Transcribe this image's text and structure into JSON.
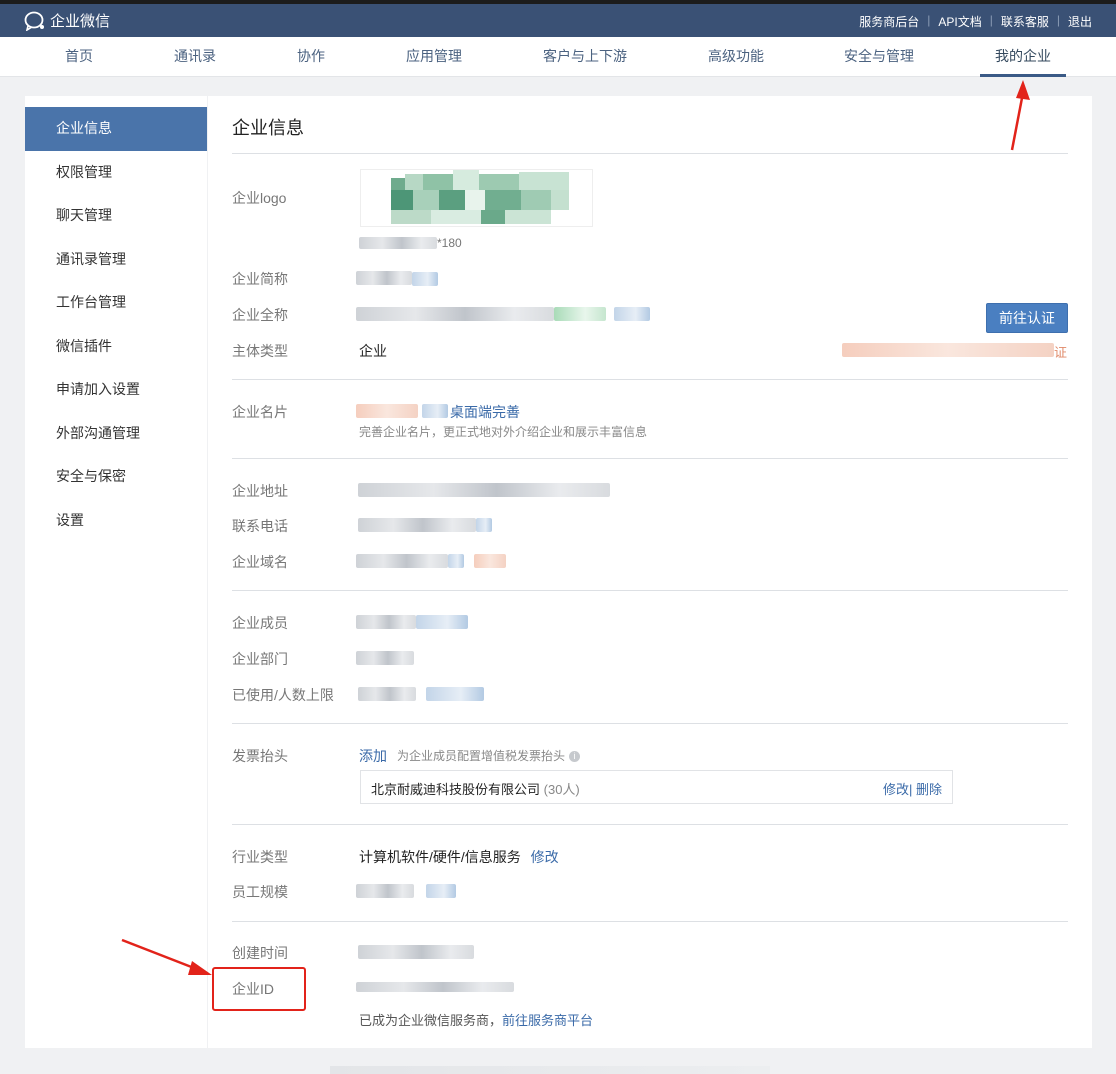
{
  "app": {
    "title": "企业微信"
  },
  "toplinks": [
    {
      "label": "服务商后台"
    },
    {
      "label": "API文档"
    },
    {
      "label": "联系客服"
    },
    {
      "label": "退出"
    }
  ],
  "nav": [
    {
      "label": "首页"
    },
    {
      "label": "通讯录"
    },
    {
      "label": "协作"
    },
    {
      "label": "应用管理"
    },
    {
      "label": "客户与上下游"
    },
    {
      "label": "高级功能"
    },
    {
      "label": "安全与管理"
    },
    {
      "label": "我的企业"
    }
  ],
  "sidebar": {
    "items": [
      {
        "label": "企业信息"
      },
      {
        "label": "权限管理"
      },
      {
        "label": "聊天管理"
      },
      {
        "label": "通讯录管理"
      },
      {
        "label": "工作台管理"
      },
      {
        "label": "微信插件"
      },
      {
        "label": "申请加入设置"
      },
      {
        "label": "外部沟通管理"
      },
      {
        "label": "安全与保密"
      },
      {
        "label": "设置"
      }
    ]
  },
  "page": {
    "title": "企业信息",
    "logo": {
      "label": "企业logo",
      "size_hint": "*180"
    },
    "short_name": {
      "label": "企业简称"
    },
    "full_name": {
      "label": "企业全称",
      "verify_button": "前往认证"
    },
    "entity_type": {
      "label": "主体类型",
      "value": "企业",
      "right_suffix": "证"
    },
    "card": {
      "label": "企业名片",
      "link": "桌面端完善",
      "hint": "完善企业名片，更正式地对外介绍企业和展示丰富信息"
    },
    "address": {
      "label": "企业地址"
    },
    "phone": {
      "label": "联系电话"
    },
    "domain": {
      "label": "企业域名"
    },
    "members": {
      "label": "企业成员"
    },
    "departments": {
      "label": "企业部门"
    },
    "usage": {
      "label": "已使用/人数上限"
    },
    "invoice": {
      "label": "发票抬头",
      "add_link": "添加",
      "hint": "为企业成员配置增值税发票抬头",
      "info_icon": "i",
      "entry_name": "北京耐威迪科技股份有限公司",
      "entry_count": "(30人)",
      "edit_label": "修改",
      "separator": "|",
      "delete_label": "删除"
    },
    "industry": {
      "label": "行业类型",
      "value": "计算机软件/硬件/信息服务",
      "edit_link": "修改"
    },
    "staff_size": {
      "label": "员工规模"
    },
    "created": {
      "label": "创建时间"
    },
    "corp_id": {
      "label": "企业ID",
      "hint": "已成为企业微信服务商，",
      "link": "前往服务商平台"
    }
  },
  "colors": {
    "topbar": "#3a5175",
    "active_sidebar": "#4a74aa",
    "link": "#3a6aa8",
    "verify_button": "#4a7fc1",
    "annotation_red": "#e2231a"
  }
}
